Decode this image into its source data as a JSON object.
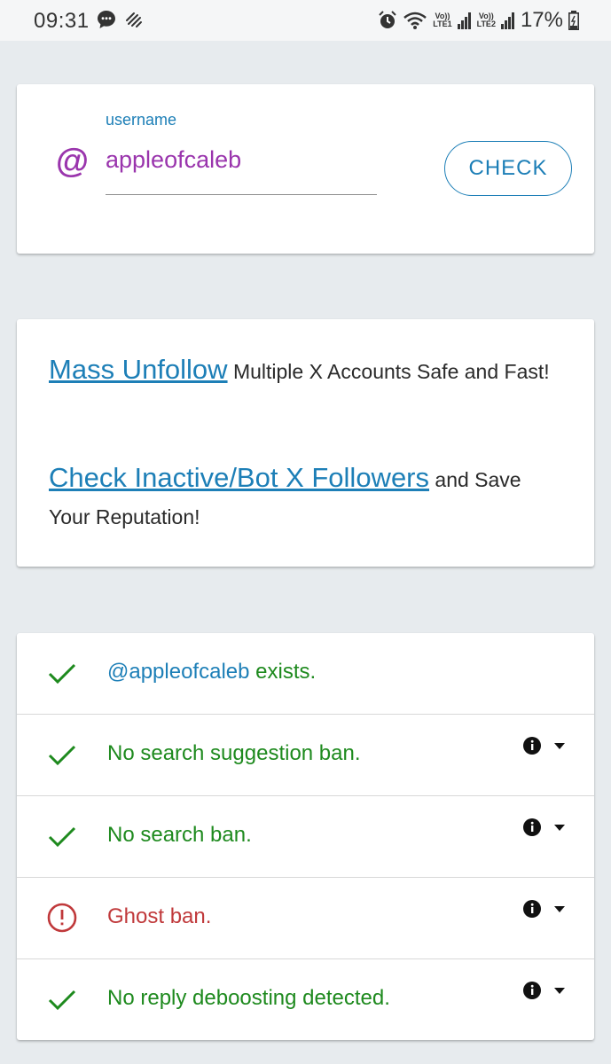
{
  "status_bar": {
    "time": "09:31",
    "net1": "LTE1",
    "net2": "LTE2",
    "volte": "Vo))",
    "battery": "17%"
  },
  "username_card": {
    "label": "username",
    "prefix": "@",
    "value": "appleofcaleb",
    "check_label": "CHECK"
  },
  "promo": {
    "line1_link": "Mass Unfollow",
    "line1_rest": "Multiple X Accounts Safe and Fast!",
    "line2_link": "Check Inactive/Bot X Followers",
    "line2_rest": "and Save Your Reputation!"
  },
  "results": [
    {
      "status": "ok",
      "mention": "@appleofcaleb",
      "text": "exists.",
      "has_info": false
    },
    {
      "status": "ok",
      "mention": "",
      "text": "No search suggestion ban.",
      "has_info": true
    },
    {
      "status": "ok",
      "mention": "",
      "text": "No search ban.",
      "has_info": true
    },
    {
      "status": "bad",
      "mention": "",
      "text": "Ghost ban.",
      "has_info": true
    },
    {
      "status": "ok",
      "mention": "",
      "text": "No reply deboosting detected.",
      "has_info": true
    }
  ],
  "colors": {
    "accent_blue": "#1d7fb7",
    "accent_purple": "#9a35ad",
    "ok_green": "#1e8a1e",
    "bad_red": "#c0393b"
  }
}
